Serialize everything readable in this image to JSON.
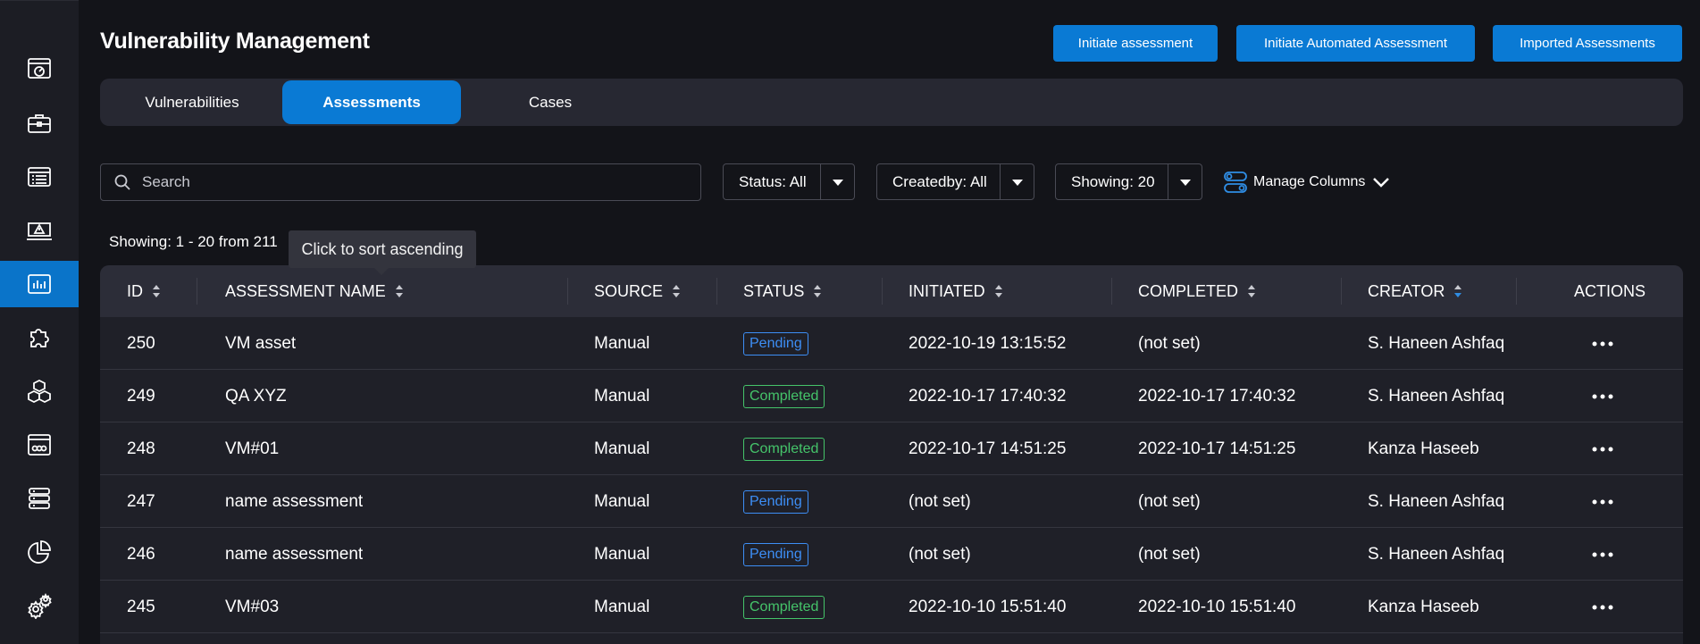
{
  "sidebar": {
    "items": [
      {
        "icon": "dashboard-icon",
        "active": false
      },
      {
        "icon": "briefcase-icon",
        "active": false
      },
      {
        "icon": "list-icon",
        "active": false
      },
      {
        "icon": "monitor-alert-icon",
        "active": false
      },
      {
        "icon": "bar-chart-icon",
        "active": true
      },
      {
        "icon": "puzzle-icon",
        "active": false
      },
      {
        "icon": "cubes-icon",
        "active": false
      },
      {
        "icon": "dashboard-panel-icon",
        "active": false
      },
      {
        "icon": "server-icon",
        "active": false
      },
      {
        "icon": "pie-chart-icon",
        "active": false
      },
      {
        "icon": "gears-icon",
        "active": false
      }
    ]
  },
  "header": {
    "title": "Vulnerability Management",
    "buttons": {
      "initiate": "Initiate assessment",
      "automated": "Initiate Automated Assessment",
      "imported": "Imported Assessments"
    }
  },
  "tabs": [
    {
      "label": "Vulnerabilities",
      "active": false
    },
    {
      "label": "Assessments",
      "active": true
    },
    {
      "label": "Cases",
      "active": false
    }
  ],
  "filters": {
    "search_placeholder": "Search",
    "status": "Status: All",
    "createdby": "Createdby: All",
    "showing": "Showing: 20",
    "manage_columns": "Manage Columns"
  },
  "summary": "Showing: 1 - 20 from 211",
  "tooltip": "Click to sort ascending",
  "table": {
    "headers": [
      "ID",
      "ASSESSMENT NAME",
      "SOURCE",
      "STATUS",
      "INITIATED",
      "COMPLETED",
      "CREATOR",
      "ACTIONS"
    ],
    "rows": [
      {
        "id": "250",
        "name": "VM asset",
        "source": "Manual",
        "status": "Pending",
        "initiated": "2022-10-19 13:15:52",
        "completed": "(not set)",
        "creator": "S. Haneen Ashfaq"
      },
      {
        "id": "249",
        "name": "QA XYZ",
        "source": "Manual",
        "status": "Completed",
        "initiated": "2022-10-17 17:40:32",
        "completed": "2022-10-17 17:40:32",
        "creator": "S. Haneen Ashfaq"
      },
      {
        "id": "248",
        "name": "VM#01",
        "source": "Manual",
        "status": "Completed",
        "initiated": "2022-10-17 14:51:25",
        "completed": "2022-10-17 14:51:25",
        "creator": "Kanza Haseeb"
      },
      {
        "id": "247",
        "name": "name assessment",
        "source": "Manual",
        "status": "Pending",
        "initiated": "(not set)",
        "completed": "(not set)",
        "creator": "S. Haneen Ashfaq"
      },
      {
        "id": "246",
        "name": "name assessment",
        "source": "Manual",
        "status": "Pending",
        "initiated": "(not set)",
        "completed": "(not set)",
        "creator": "S. Haneen Ashfaq"
      },
      {
        "id": "245",
        "name": "VM#03",
        "source": "Manual",
        "status": "Completed",
        "initiated": "2022-10-10 15:51:40",
        "completed": "2022-10-10 15:51:40",
        "creator": "Kanza Haseeb"
      }
    ]
  },
  "colors": {
    "accent": "#0a7ad4",
    "pending": "#3d8ef5",
    "completed": "#45c46a",
    "sort_active": "#2f8de4"
  }
}
